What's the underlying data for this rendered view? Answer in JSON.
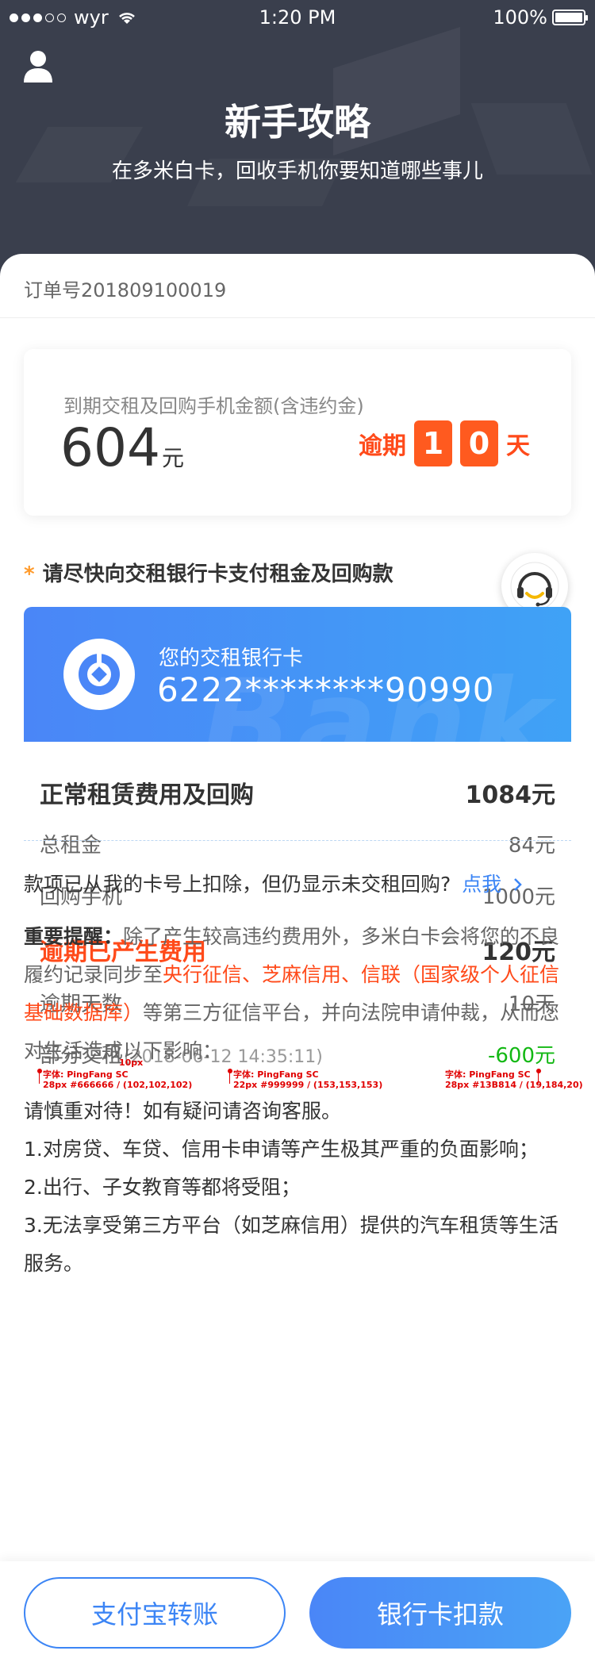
{
  "status_bar": {
    "carrier": "wyr",
    "time": "1:20 PM",
    "battery": "100%"
  },
  "header": {
    "title": "新手攻略",
    "subtitle": "在多米白卡，回收手机你要知道哪些事儿"
  },
  "order": {
    "number": "订单号201809100019"
  },
  "due_card": {
    "label": "到期交租及回购手机金额(含违约金)",
    "amount": "604",
    "unit": "元",
    "overdue_prefix": "逾期",
    "overdue_digit_1": "1",
    "overdue_digit_2": "0",
    "overdue_suffix": "天"
  },
  "notice": {
    "star": "*",
    "text": "请尽快向交租银行卡支付租金及回购款"
  },
  "bank_card": {
    "label": "您的交租银行卡",
    "number": "6222********90990",
    "watermark": "Bank"
  },
  "fees": {
    "normal_label": "正常租赁费用及回购",
    "normal_value": "1084元",
    "rent_label": "总租金",
    "rent_value": "84元",
    "buyback_label": "回购手机",
    "buyback_value": "1000元",
    "overdue_label": "逾期已产生费用",
    "overdue_value": "120元",
    "overdue_days_label": "逾期天数",
    "overdue_days_value": "10天",
    "partial_label": "部分交租",
    "partial_time": "(2018-06-12 14:35:11)",
    "partial_value": "-600元"
  },
  "annotations": {
    "a1_line1": "字体: PingFang SC",
    "a1_line2": "28px #666666 / (102,102,102)",
    "a_spacing": "10px",
    "a2_line1": "字体: PingFang SC",
    "a2_line2": "22px #999999 / (153,153,153)",
    "a3_line1": "字体: PingFang SC",
    "a3_line2": "28px #13B814 / (19,184,20)"
  },
  "deduct": {
    "text": "款项已从我的卡号上扣除，但仍显示未交租回购?",
    "link": "点我"
  },
  "important": {
    "bold_prefix": "重要提醒：",
    "part1": "除了产生较高违约费用外，多米白卡会将您的不良履约记录同步至",
    "red_part": "央行征信、芝麻信用、信联（国家级个人征信基础数据库）",
    "part2": "等第三方征信平台，并向法院申请仲裁，从而您对生活造成以下影响："
  },
  "consequences": {
    "caution": "请慎重对待！如有疑问请咨询客服。",
    "item1": "1.对房贷、车贷、信用卡申请等产生极其严重的负面影响；",
    "item2": "2.出行、子女教育等都将受阻；",
    "item3": "3.无法享受第三方平台（如芝麻信用）提供的汽车租赁等生活服务。"
  },
  "buttons": {
    "alipay": "支付宝转账",
    "bank": "银行卡扣款"
  },
  "colors": {
    "header_bg": "#3a3f4d",
    "accent_blue": "#3c85f5",
    "warning_red": "#ff4a1a",
    "success_green": "#13b814"
  }
}
